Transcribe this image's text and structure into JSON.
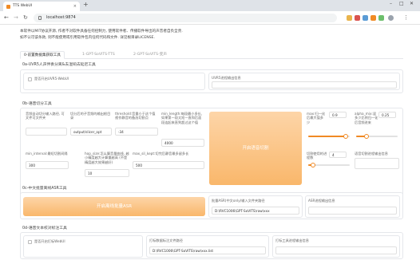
{
  "browser": {
    "tab_title": "TTS WebUI",
    "new_tab": "+",
    "url": "localhost:9874",
    "win_min": "–",
    "win_max": "□",
    "win_close": "✕"
  },
  "notice": {
    "line1": "本软件以MIT协议开源, 作者不对软件具备任何控制力, 使用软件者、传播软件导出的声音者自负全责.",
    "line2": "如不认可该条款, 则不能使用或引用软件包内任何代码和文件. 详见根目录LICENSE."
  },
  "tabs": [
    {
      "label": "0-前置数据集获取工具"
    },
    {
      "label": "1-GPT-SoVITS-TTS"
    },
    {
      "label": "2-GPT-SoVITS-变声"
    }
  ],
  "sec0a": {
    "title": "0a-UVR5人声伴奏分离&去混响去延迟工具",
    "checkbox_label": "是否开启UVR5-WebUI",
    "status_label": "UVR5进程输出信息"
  },
  "sec0b": {
    "title": "0b-语音切分工具",
    "input_path_label": "音频自动切分输入路径, 可文件可文件夹",
    "input_path_value": "",
    "output_dir_label": "切分后的子音频的输出根目录",
    "output_dir_value": "output/slicer_opt",
    "threshold_label": "threshold:音量小于这个值视作静音的备选切割点",
    "threshold_value": "-34",
    "min_length_label": "min_length:每段最小多长, 如果第一段太短一直和后面段连起来直到超过这个值",
    "min_length_value": "4000",
    "min_interval_label": "min_interval:最短切割间隔",
    "min_interval_value": "300",
    "hop_size_label": "hop_size:怎么算音量曲线, 越小精度越大计算量越高 (不是精度越大效果越好)",
    "hop_size_value": "10",
    "max_sil_label": "max_sil_kept:切完后静音最多留多长",
    "max_sil_value": "500",
    "start_button": "开启语音切割",
    "max_label": "max:归一化后最大值多少",
    "max_value": "0.9",
    "alpha_label": "alpha_mix:混多少比例归一化后音频进来",
    "alpha_value": "0.25",
    "process_label": "切割使用的进程数",
    "process_value": "4",
    "status_label": "语音切割进程输出信息",
    "max_fraction": 0.9,
    "alpha_fraction": 0.25,
    "process_fraction": 0.12
  },
  "sec0c": {
    "title": "0c-中文批量离线ASR工具",
    "start_button": "开启离线批量ASR",
    "input_label": "批量ASR(中文only)输入文件夹路径",
    "input_value": "D:\\RVC1006\\GPT-SoVITS\\raw\\xxx",
    "status_label": "ASR进程输出信息"
  },
  "sec0d": {
    "title": "0d-语音文本校对标注工具",
    "checkbox_label": "是否开启打标WebUI",
    "file_label": "打标数据标注文件路径",
    "file_value": "D:\\RVC1006\\GPT-SoVITS\\raw\\xxx.list",
    "status_label": "打标工具进程输出信息"
  }
}
